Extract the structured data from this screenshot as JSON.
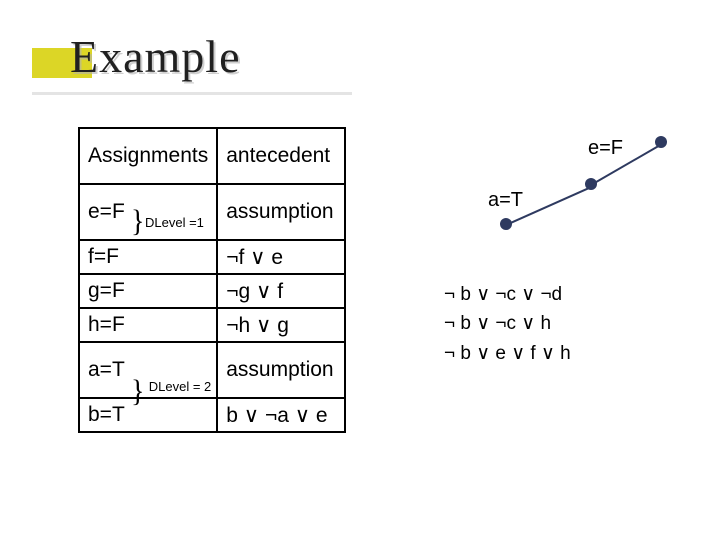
{
  "title": "Example",
  "table": {
    "headers": {
      "assignments": "Assignments",
      "antecedent": "antecedent"
    },
    "rows": [
      {
        "assign": "e=F",
        "ant": "assumption",
        "dlevel": "DLevel =1"
      },
      {
        "assign": "f=F",
        "ant": "¬f ∨ e"
      },
      {
        "assign": "g=F",
        "ant": "¬g ∨ f"
      },
      {
        "assign": "h=F",
        "ant": "¬h ∨ g"
      },
      {
        "assign": "a=T",
        "ant": "assumption",
        "dlevel": "DLevel = 2"
      },
      {
        "assign": "b=T",
        "ant": "b ∨ ¬a ∨ e"
      }
    ]
  },
  "graph": {
    "labels": {
      "eF": "e=F",
      "aT": "a=T"
    }
  },
  "clauses": [
    "¬ b ∨ ¬c ∨ ¬d",
    "¬ b ∨ ¬c ∨ h",
    "¬ b ∨   e ∨ f ∨ h"
  ]
}
